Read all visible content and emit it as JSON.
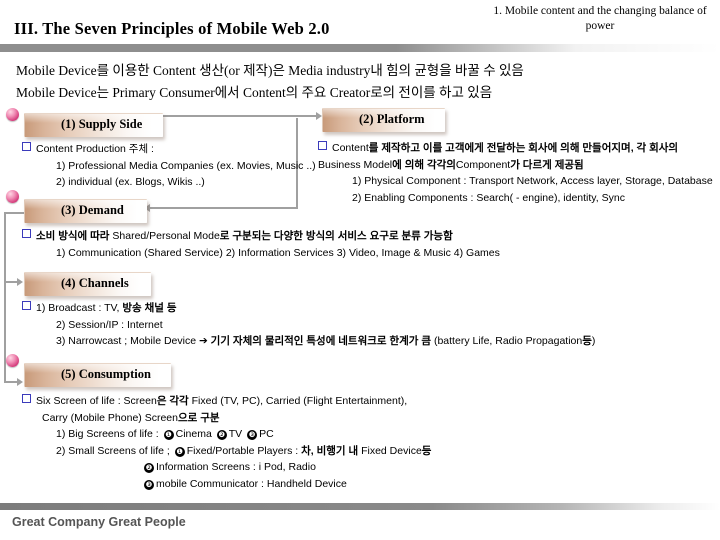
{
  "header": {
    "title": "III. The Seven Principles of Mobile Web 2.0",
    "subtitle": "1. Mobile content and the changing balance of power"
  },
  "intro": {
    "line1": "Mobile Device를 이용한 Content 생산(or 제작)은 Media industry내 힘의 균형을 바꿀 수 있음",
    "line2": "Mobile Device는 Primary Consumer에서 Content의 주요 Creator로의 전이를 하고 있음"
  },
  "sections": {
    "supply": {
      "banner": "(1) Supply Side",
      "l1": "Content Production 주체 :",
      "l2": "1) Professional Media Companies (ex. Movies, Music ..)",
      "l3": "2) individual (ex. Blogs, Wikis ..)"
    },
    "platform": {
      "banner": "(2) Platform",
      "l1a": "Content",
      "l1b": "를 제작하고 이를 고객에게 전달하는 회사에 의해 만들어지며, 각 회사의",
      "l2a": "Business Model",
      "l2b": "에 의해 각각의",
      "l2c": "Component",
      "l2d": "가 다르게 제공됨",
      "l3": "1) Physical Component : Transport Network, Access layer, Storage, Database",
      "l4": "2) Enabling Components : Search( - engine), identity, Sync"
    },
    "demand": {
      "banner": "(3) Demand",
      "l1a": "소비 방식에 따라",
      "l1b": "Shared/Personal Mode",
      "l1c": "로 구분되는 다양한 방식의 서비스 요구로 분류 가능함",
      "l2": "1) Communication (Shared Service)    2) Information Services    3) Video, Image & Music    4) Games"
    },
    "channels": {
      "banner": "(4) Channels",
      "l1a": "1) Broadcast : TV,",
      "l1b": "방송 채널 등",
      "l2": "2) Session/IP : Internet",
      "l3a": "3) Narrowcast ; Mobile Device",
      "l3b": "➔ 기기 자체의 물리적인 특성에 네트워크로 한계가 큼",
      "l3c": "(battery Life, Radio Propagation",
      "l3d": "등",
      "l3e": ")"
    },
    "consumption": {
      "banner": "(5) Consumption",
      "l1a": "Six Screen of life : Screen",
      "l1b": "은 각각",
      "l1c": "Fixed (TV, PC), Carried (Flight Entertainment),",
      "l2a": "Carry (Mobile Phone) Screen",
      "l2b": "으로 구분",
      "l3a": "1) Big Screens of life :",
      "l3b": "Cinema",
      "l3c": "TV",
      "l3d": "PC",
      "l4a": "2) Small Screens of life ;",
      "l4b": "Fixed/Portable Players :",
      "l4c": "차, 비행기 내",
      "l4d": "Fixed Device",
      "l4e": "등",
      "l5a": "Information Screens : i Pod, Radio",
      "l6a": "mobile Communicator : Handheld Device",
      "num1": "❶",
      "num2": "❷",
      "num3": "❸"
    }
  },
  "footer": {
    "text": "Great Company  Great People"
  },
  "colors": {
    "banner_start": "#c89a7a",
    "orb": "#d63f7e",
    "rule": "#8e8e8e",
    "footer_text": "#555555",
    "bullet_square": "#3b3bbb",
    "connector": "#a0a0a0"
  }
}
